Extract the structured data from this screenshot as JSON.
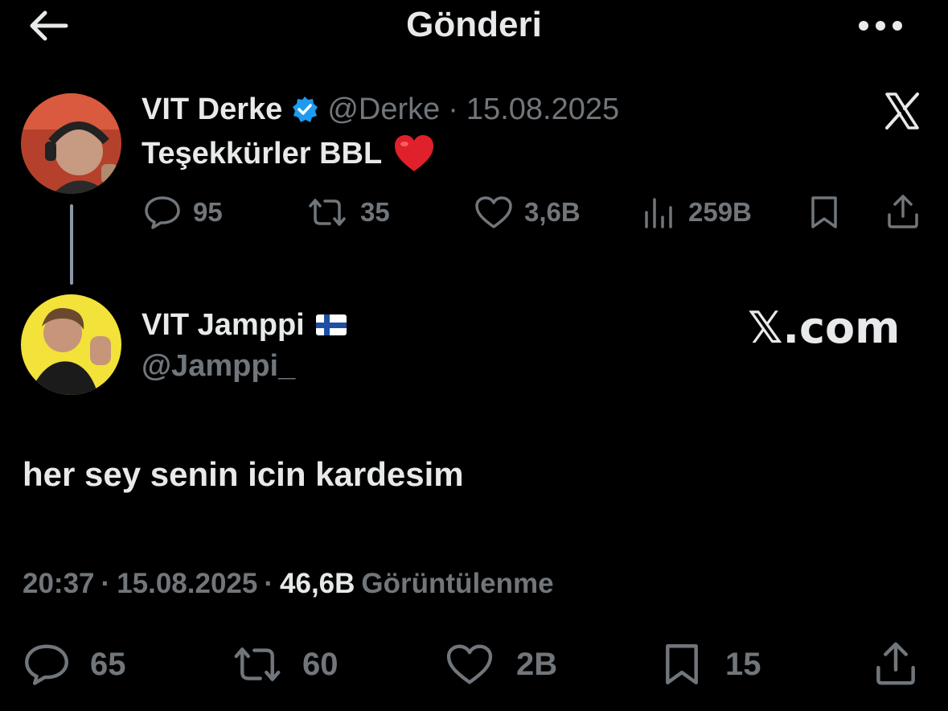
{
  "header": {
    "title": "Gönderi",
    "back_icon": "arrow-left-icon",
    "more_icon": "more-horizontal-icon"
  },
  "parent_post": {
    "display_name": "VIT Derke",
    "verified_icon": "verified-badge-icon",
    "handle": "@Derke",
    "separator": "·",
    "date": "15.08.2025",
    "text": "Teşekkürler BBL",
    "emoji": "❤️",
    "brand_icon": "x-logo-icon",
    "actions": {
      "replies": "95",
      "reposts": "35",
      "likes": "3,6B",
      "views": "259B"
    }
  },
  "main_post": {
    "display_name": "VIT Jamppi",
    "flag": "finland-flag-icon",
    "handle": "@Jamppi_",
    "watermark": "𝕏.com",
    "text": "her sey senin icin kardesim",
    "time": "20:37",
    "sep1": "·",
    "date": "15.08.2025",
    "sep2": "·",
    "view_count": "46,6B",
    "view_label": "Görüntülenme",
    "actions": {
      "replies": "65",
      "reposts": "60",
      "likes": "2B",
      "bookmarks": "15"
    }
  },
  "colors": {
    "background": "#000000",
    "text_primary": "#e7e9ea",
    "text_muted": "#71767b",
    "verified": "#1d9bf0",
    "heart": "#f91880"
  }
}
